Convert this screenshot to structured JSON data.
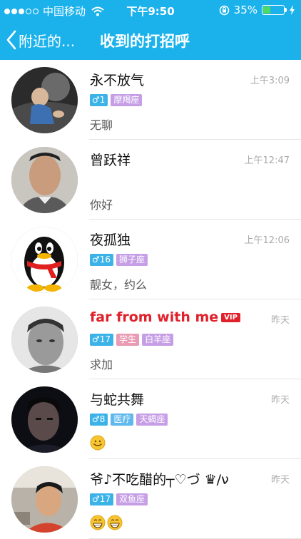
{
  "status_bar": {
    "carrier": "中国移动",
    "time": "下午9:50",
    "battery": "35%",
    "battery_level": 0.35
  },
  "nav": {
    "back_label": "附近的...",
    "title": "收到的打招呼"
  },
  "items": [
    {
      "name": "永不放气",
      "time": "上午3:09",
      "age": "1",
      "tags": [
        "摩羯座"
      ],
      "message": "无聊"
    },
    {
      "name": "曾跃祥",
      "time": "上午12:47",
      "message": "你好"
    },
    {
      "name": "夜孤独",
      "time": "上午12:06",
      "age": "16",
      "tags": [
        "狮子座"
      ],
      "message": "靓女，约么"
    },
    {
      "name": "far from with me",
      "vip": "VIP",
      "time": "昨天",
      "age": "17",
      "tags": [
        "学生",
        "白羊座"
      ],
      "message": "求加"
    },
    {
      "name": "与蛇共舞",
      "time": "昨天",
      "age": "8",
      "tags": [
        "医疗",
        "天蝎座"
      ],
      "message_icons": [
        "smile-emoji-icon"
      ]
    },
    {
      "name": "爷♪不吃醋的┬♡づ ♛/ν",
      "time": "昨天",
      "age": "17",
      "tags": [
        "双鱼座"
      ],
      "message_icons": [
        "grin-emoji-icon",
        "grin-emoji-icon"
      ]
    }
  ]
}
